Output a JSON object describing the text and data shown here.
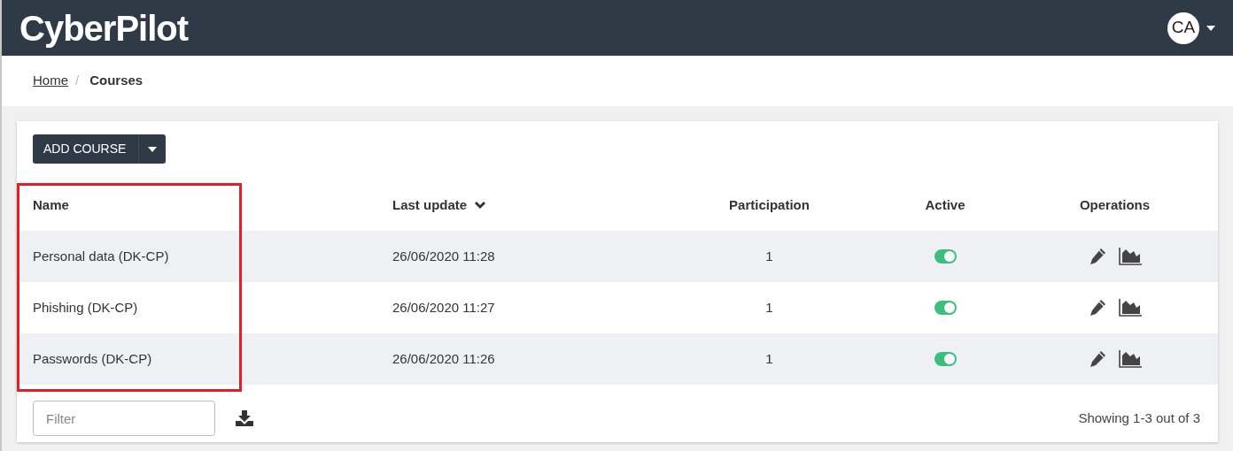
{
  "header": {
    "logo": "CyberPilot",
    "avatar": "CA"
  },
  "breadcrumb": [
    {
      "label": "Home",
      "current": false
    },
    {
      "label": "Courses",
      "current": true
    }
  ],
  "breadcrumb_separator": "/",
  "add_button": {
    "label": "ADD COURSE"
  },
  "table": {
    "columns": [
      {
        "label": "Name",
        "sorted": false
      },
      {
        "label": "Last update",
        "sorted": true
      },
      {
        "label": "Participation",
        "sorted": false
      },
      {
        "label": "Active",
        "sorted": false
      },
      {
        "label": "Operations",
        "sorted": false
      }
    ],
    "rows": [
      {
        "name": "Personal data (DK-CP)",
        "updated": "26/06/2020 11:28",
        "participation": "1",
        "active": true
      },
      {
        "name": "Phishing (DK-CP)",
        "updated": "26/06/2020 11:27",
        "participation": "1",
        "active": true
      },
      {
        "name": "Passwords (DK-CP)",
        "updated": "26/06/2020 11:26",
        "participation": "1",
        "active": true
      }
    ]
  },
  "highlight_frame": true,
  "filter": {
    "placeholder": "Filter"
  },
  "summary": "Showing 1-3 out of 3"
}
